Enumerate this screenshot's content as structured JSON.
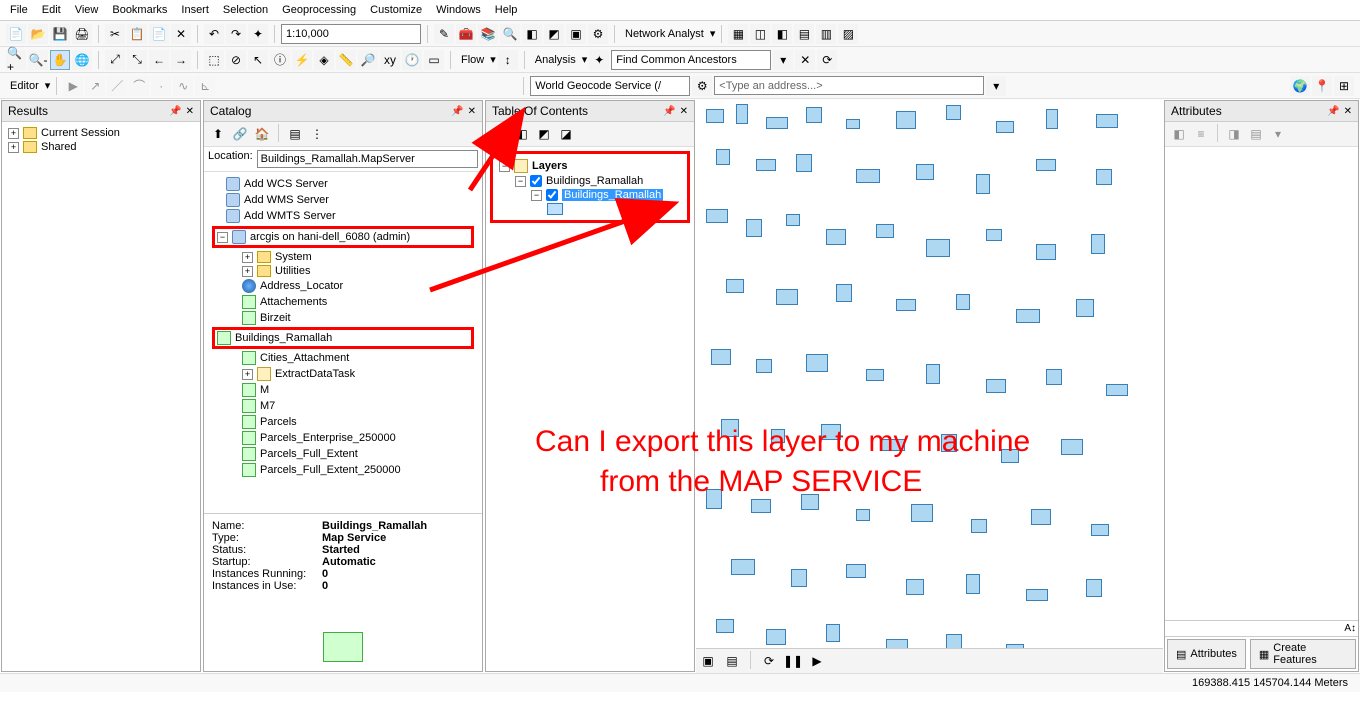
{
  "menu": [
    "File",
    "Edit",
    "View",
    "Bookmarks",
    "Insert",
    "Selection",
    "Geoprocessing",
    "Customize",
    "Windows",
    "Help"
  ],
  "scale": "1:10,000",
  "network_analyst_label": "Network Analyst",
  "flow_label": "Flow",
  "analysis_label": "Analysis",
  "find_ancestors": "Find Common Ancestors",
  "editor_label": "Editor",
  "geocode_service": "World Geocode Service (/",
  "address_placeholder": "<Type an address...>",
  "panels": {
    "results": {
      "title": "Results",
      "items": [
        "Current Session",
        "Shared"
      ]
    },
    "catalog": {
      "title": "Catalog",
      "location_label": "Location:",
      "location_value": "Buildings_Ramallah.MapServer",
      "server_nodes": [
        "Add WCS Server",
        "Add WMS Server",
        "Add WMTS Server"
      ],
      "conn": "arcgis on hani-dell_6080 (admin)",
      "folders": [
        "System",
        "Utilities"
      ],
      "services": [
        "Address_Locator",
        "Attachements",
        "Birzeit",
        "Buildings_Ramallah",
        "Cities_Attachment",
        "ExtractDataTask",
        "M",
        "M7",
        "Parcels",
        "Parcels_Enterprise_250000",
        "Parcels_Full_Extent",
        "Parcels_Full_Extent_250000"
      ],
      "highlighted_service": "Buildings_Ramallah",
      "details": {
        "Name:": "Buildings_Ramallah",
        "Type:": "Map Service",
        "Status:": "Started",
        "Startup:": "Automatic",
        "Instances Running:": "0",
        "Instances in Use:": "0"
      }
    },
    "toc": {
      "title": "Table Of Contents",
      "root": "Layers",
      "layer": "Buildings_Ramallah",
      "sublayer": "Buildings_Ramallah"
    },
    "attributes": {
      "title": "Attributes"
    }
  },
  "annotation": {
    "line1": "Can I export this layer to my machine",
    "line2": "from the MAP SERVICE"
  },
  "footer_tabs": [
    "Attributes",
    "Create Features"
  ],
  "coords": "169388.415 145704.144 Meters"
}
